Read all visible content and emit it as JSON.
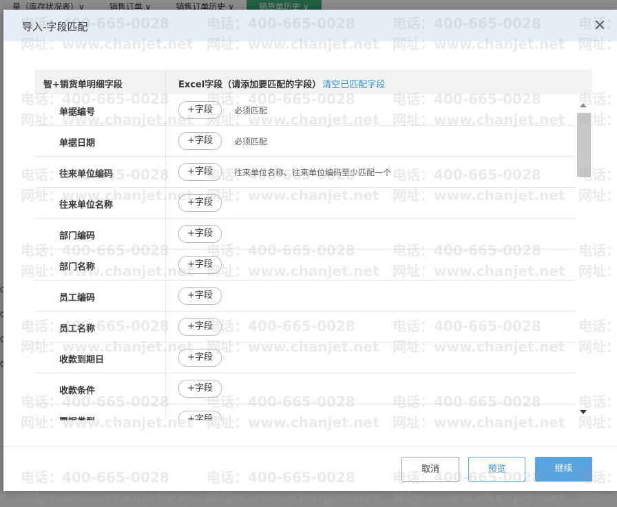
{
  "background": {
    "tabs": [
      {
        "label": "量（库存状况表）∨"
      },
      {
        "label": "销售订单 ∨"
      },
      {
        "label": "销售订单历史 ∨"
      },
      {
        "label": "销货单历史 ∨"
      }
    ],
    "side_numbers": [
      "0",
      "0",
      "0",
      "0"
    ]
  },
  "modal": {
    "title": "导入-字段匹配",
    "table": {
      "col1_header": "智+销货单明细字段",
      "col2_header": "Excel字段（请添加要匹配的字段）",
      "clear_link": "清空已匹配字段"
    },
    "rows": [
      {
        "name": "单据编号",
        "button": "+字段",
        "hint": "必须匹配"
      },
      {
        "name": "单据日期",
        "button": "+字段",
        "hint": "必须匹配"
      },
      {
        "name": "往来单位编码",
        "button": "+字段",
        "hint": "往来单位名称、往来单位编码至少匹配一个"
      },
      {
        "name": "往来单位名称",
        "button": "+字段",
        "hint": ""
      },
      {
        "name": "部门编码",
        "button": "+字段",
        "hint": ""
      },
      {
        "name": "部门名称",
        "button": "+字段",
        "hint": ""
      },
      {
        "name": "员工编码",
        "button": "+字段",
        "hint": ""
      },
      {
        "name": "员工名称",
        "button": "+字段",
        "hint": ""
      },
      {
        "name": "收款到期日",
        "button": "+字段",
        "hint": ""
      },
      {
        "name": "收款条件",
        "button": "+字段",
        "hint": ""
      },
      {
        "name": "票据类型",
        "button": "+字段",
        "hint": ""
      }
    ],
    "buttons": {
      "cancel": "取消",
      "preview": "预览",
      "continue": "继续"
    }
  },
  "watermark": {
    "phone": "电话：400-665-0028",
    "url": "网址：www.chanjet.net"
  },
  "colors": {
    "header_bg": "#e6edf7",
    "link": "#2f8fd1",
    "primary": "#5aa3e0",
    "active_tab": "#3fae7a"
  }
}
